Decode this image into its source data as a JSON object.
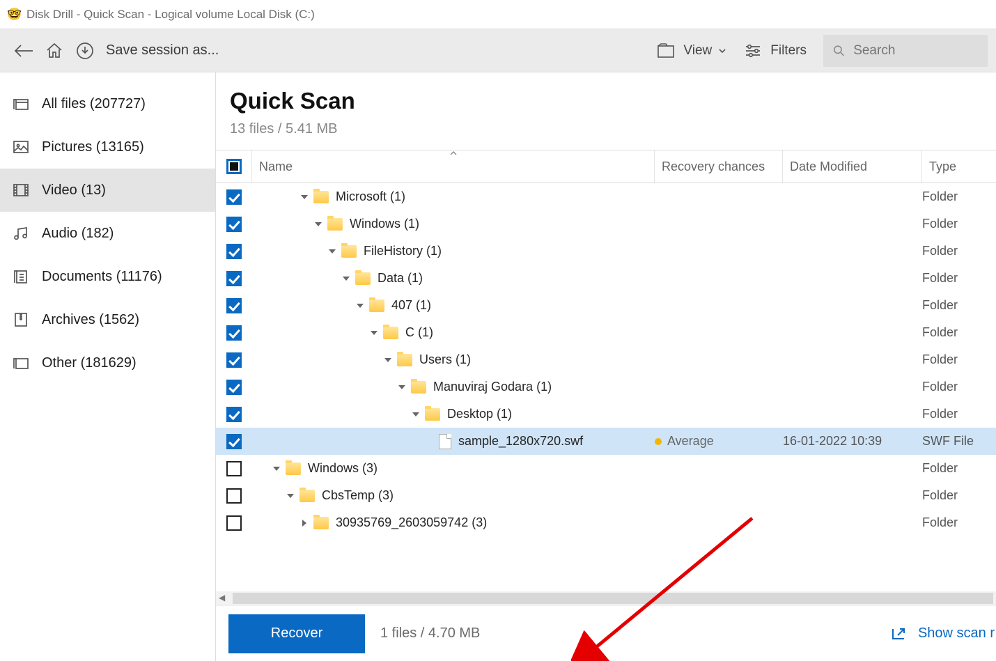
{
  "window": {
    "title": "Disk Drill - Quick Scan - Logical volume Local Disk (C:)"
  },
  "toolbar": {
    "save_session": "Save session as...",
    "view": "View",
    "filters": "Filters",
    "search_placeholder": "Search"
  },
  "sidebar": {
    "items": [
      {
        "label": "All files (207727)"
      },
      {
        "label": "Pictures (13165)"
      },
      {
        "label": "Video (13)",
        "selected": true
      },
      {
        "label": "Audio (182)"
      },
      {
        "label": "Documents (11176)"
      },
      {
        "label": "Archives (1562)"
      },
      {
        "label": "Other (181629)"
      }
    ]
  },
  "header": {
    "title": "Quick Scan",
    "subtitle": "13 files / 5.41 MB"
  },
  "columns": {
    "name": "Name",
    "chance": "Recovery chances",
    "modified": "Date Modified",
    "type": "Type"
  },
  "rows": [
    {
      "indent": 3,
      "checked": true,
      "expanded": true,
      "icon": "folder",
      "name": "Microsoft (1)",
      "type": "Folder"
    },
    {
      "indent": 4,
      "checked": true,
      "expanded": true,
      "icon": "folder",
      "name": "Windows (1)",
      "type": "Folder"
    },
    {
      "indent": 5,
      "checked": true,
      "expanded": true,
      "icon": "folder",
      "name": "FileHistory (1)",
      "type": "Folder"
    },
    {
      "indent": 6,
      "checked": true,
      "expanded": true,
      "icon": "folder",
      "name": "Data (1)",
      "type": "Folder"
    },
    {
      "indent": 7,
      "checked": true,
      "expanded": true,
      "icon": "folder",
      "name": "407 (1)",
      "type": "Folder"
    },
    {
      "indent": 8,
      "checked": true,
      "expanded": true,
      "icon": "folder",
      "name": "C (1)",
      "type": "Folder"
    },
    {
      "indent": 9,
      "checked": true,
      "expanded": true,
      "icon": "folder",
      "name": "Users (1)",
      "type": "Folder"
    },
    {
      "indent": 10,
      "checked": true,
      "expanded": true,
      "icon": "folder",
      "name": "Manuviraj Godara (1)",
      "type": "Folder"
    },
    {
      "indent": 11,
      "checked": true,
      "expanded": true,
      "icon": "folder",
      "name": "Desktop (1)",
      "type": "Folder"
    },
    {
      "indent": 12,
      "checked": true,
      "highlight": true,
      "icon": "file",
      "name": "sample_1280x720.swf",
      "chance": "Average",
      "chance_color": "#f3b600",
      "modified": "16-01-2022 10:39",
      "type": "SWF File"
    },
    {
      "indent": 1,
      "checked": false,
      "expanded": true,
      "icon": "folder",
      "name": "Windows (3)",
      "type": "Folder"
    },
    {
      "indent": 2,
      "checked": false,
      "expanded": true,
      "icon": "folder",
      "name": "CbsTemp (3)",
      "type": "Folder"
    },
    {
      "indent": 3,
      "checked": false,
      "expanded": false,
      "icon": "folder",
      "name": "30935769_2603059742 (3)",
      "type": "Folder"
    }
  ],
  "footer": {
    "recover": "Recover",
    "status": "1 files / 4.70 MB",
    "show_scan": "Show scan r"
  }
}
